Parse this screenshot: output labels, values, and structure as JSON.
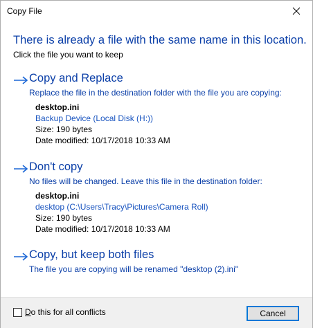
{
  "window": {
    "title": "Copy File"
  },
  "heading": "There is already a file with the same name in this location.",
  "subheading": "Click the file you want to keep",
  "options": [
    {
      "title": "Copy and Replace",
      "description": "Replace the file in the destination folder with the file you are copying:",
      "file": {
        "name": "desktop.ini",
        "location": "Backup Device (Local Disk (H:))",
        "size": "Size: 190 bytes",
        "modified": "Date modified: 10/17/2018 10:33 AM"
      }
    },
    {
      "title": "Don't copy",
      "description": "No files will be changed. Leave this file in the destination folder:",
      "file": {
        "name": "desktop.ini",
        "location": "desktop (C:\\Users\\Tracy\\Pictures\\Camera Roll)",
        "size": "Size: 190 bytes",
        "modified": "Date modified: 10/17/2018 10:33 AM"
      }
    },
    {
      "title": "Copy, but keep both files",
      "description": "The file you are copying will be renamed \"desktop (2).ini\""
    }
  ],
  "footer": {
    "checkbox_label_accel": "D",
    "checkbox_label_rest": "o this for all conflicts",
    "checkbox_checked": false,
    "cancel_label": "Cancel"
  },
  "colors": {
    "accent_text": "#0b3fa8",
    "link_text": "#1a55c0",
    "button_border": "#0078d7"
  },
  "icons": {
    "close": "close-icon",
    "arrow": "arrow-right-icon"
  }
}
